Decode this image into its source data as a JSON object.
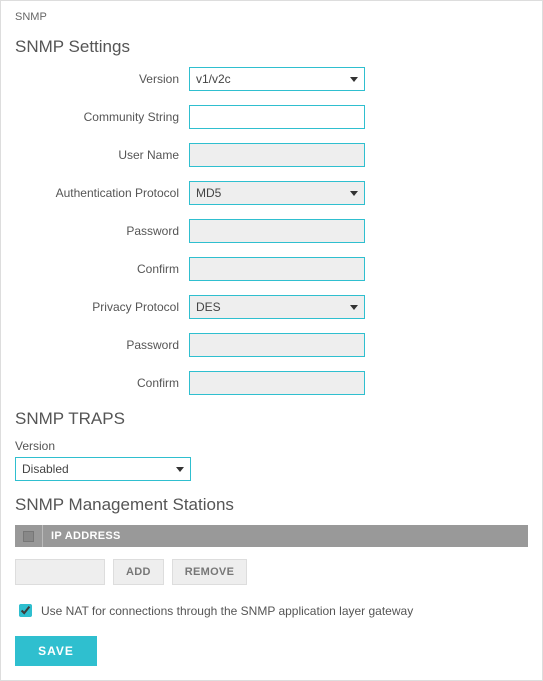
{
  "breadcrumb": "SNMP",
  "sections": {
    "settings": {
      "title": "SNMP Settings",
      "fields": {
        "version_label": "Version",
        "version_value": "v1/v2c",
        "community_label": "Community String",
        "community_value": "",
        "username_label": "User Name",
        "username_value": "",
        "auth_proto_label": "Authentication Protocol",
        "auth_proto_value": "MD5",
        "auth_pass_label": "Password",
        "auth_pass_value": "",
        "auth_confirm_label": "Confirm",
        "auth_confirm_value": "",
        "priv_proto_label": "Privacy Protocol",
        "priv_proto_value": "DES",
        "priv_pass_label": "Password",
        "priv_pass_value": "",
        "priv_confirm_label": "Confirm",
        "priv_confirm_value": ""
      }
    },
    "traps": {
      "title": "SNMP TRAPS",
      "version_label": "Version",
      "version_value": "Disabled"
    },
    "stations": {
      "title": "SNMP Management Stations",
      "column_ip": "IP ADDRESS",
      "add_label": "ADD",
      "remove_label": "REMOVE",
      "nat_label": "Use NAT for connections through the SNMP application layer gateway",
      "nat_checked": true
    }
  },
  "actions": {
    "save_label": "SAVE"
  }
}
